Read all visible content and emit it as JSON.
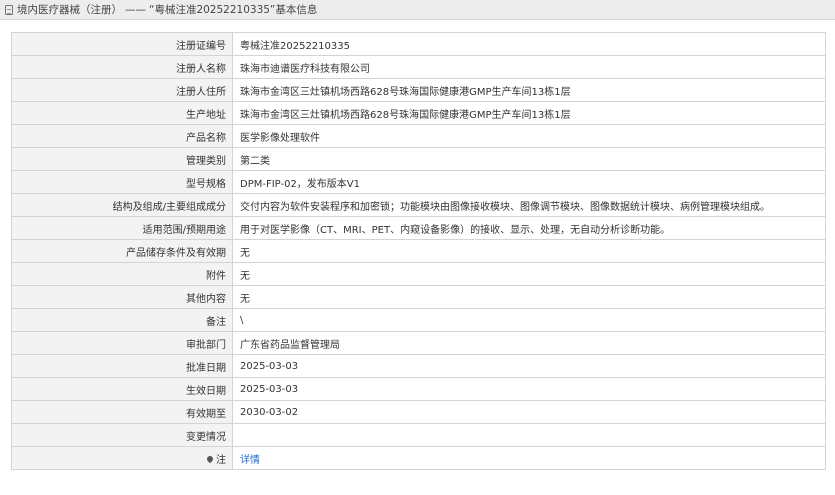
{
  "header": {
    "category": "境内医疗器械（注册）",
    "separator": "——",
    "title": "“粤械注准20252210335”基本信息"
  },
  "rows": [
    {
      "label": "注册证编号",
      "value": "粤械注准20252210335"
    },
    {
      "label": "注册人名称",
      "value": "珠海市迪谱医疗科技有限公司"
    },
    {
      "label": "注册人住所",
      "value": "珠海市金湾区三灶镇机场西路628号珠海国际健康港GMP生产车间13栋1层"
    },
    {
      "label": "生产地址",
      "value": "珠海市金湾区三灶镇机场西路628号珠海国际健康港GMP生产车间13栋1层"
    },
    {
      "label": "产品名称",
      "value": "医学影像处理软件"
    },
    {
      "label": "管理类别",
      "value": "第二类"
    },
    {
      "label": "型号规格",
      "value": "DPM-FIP-02，发布版本V1"
    },
    {
      "label": "结构及组成/主要组成成分",
      "value": "交付内容为软件安装程序和加密锁；功能模块由图像接收模块、图像调节模块、图像数据统计模块、病例管理模块组成。"
    },
    {
      "label": "适用范围/预期用途",
      "value": "用于对医学影像（CT、MRI、PET、内窥设备影像）的接收、显示、处理，无自动分析诊断功能。"
    },
    {
      "label": "产品储存条件及有效期",
      "value": "无"
    },
    {
      "label": "附件",
      "value": "无"
    },
    {
      "label": "其他内容",
      "value": "无"
    },
    {
      "label": "备注",
      "value": "\\"
    },
    {
      "label": "审批部门",
      "value": "广东省药品监督管理局"
    },
    {
      "label": "批准日期",
      "value": "2025-03-03"
    },
    {
      "label": "生效日期",
      "value": "2025-03-03"
    },
    {
      "label": "有效期至",
      "value": "2030-03-02"
    },
    {
      "label": "变更情况",
      "value": ""
    }
  ],
  "note_row": {
    "label": "注",
    "link": "详情",
    "icon": "pin-icon"
  }
}
